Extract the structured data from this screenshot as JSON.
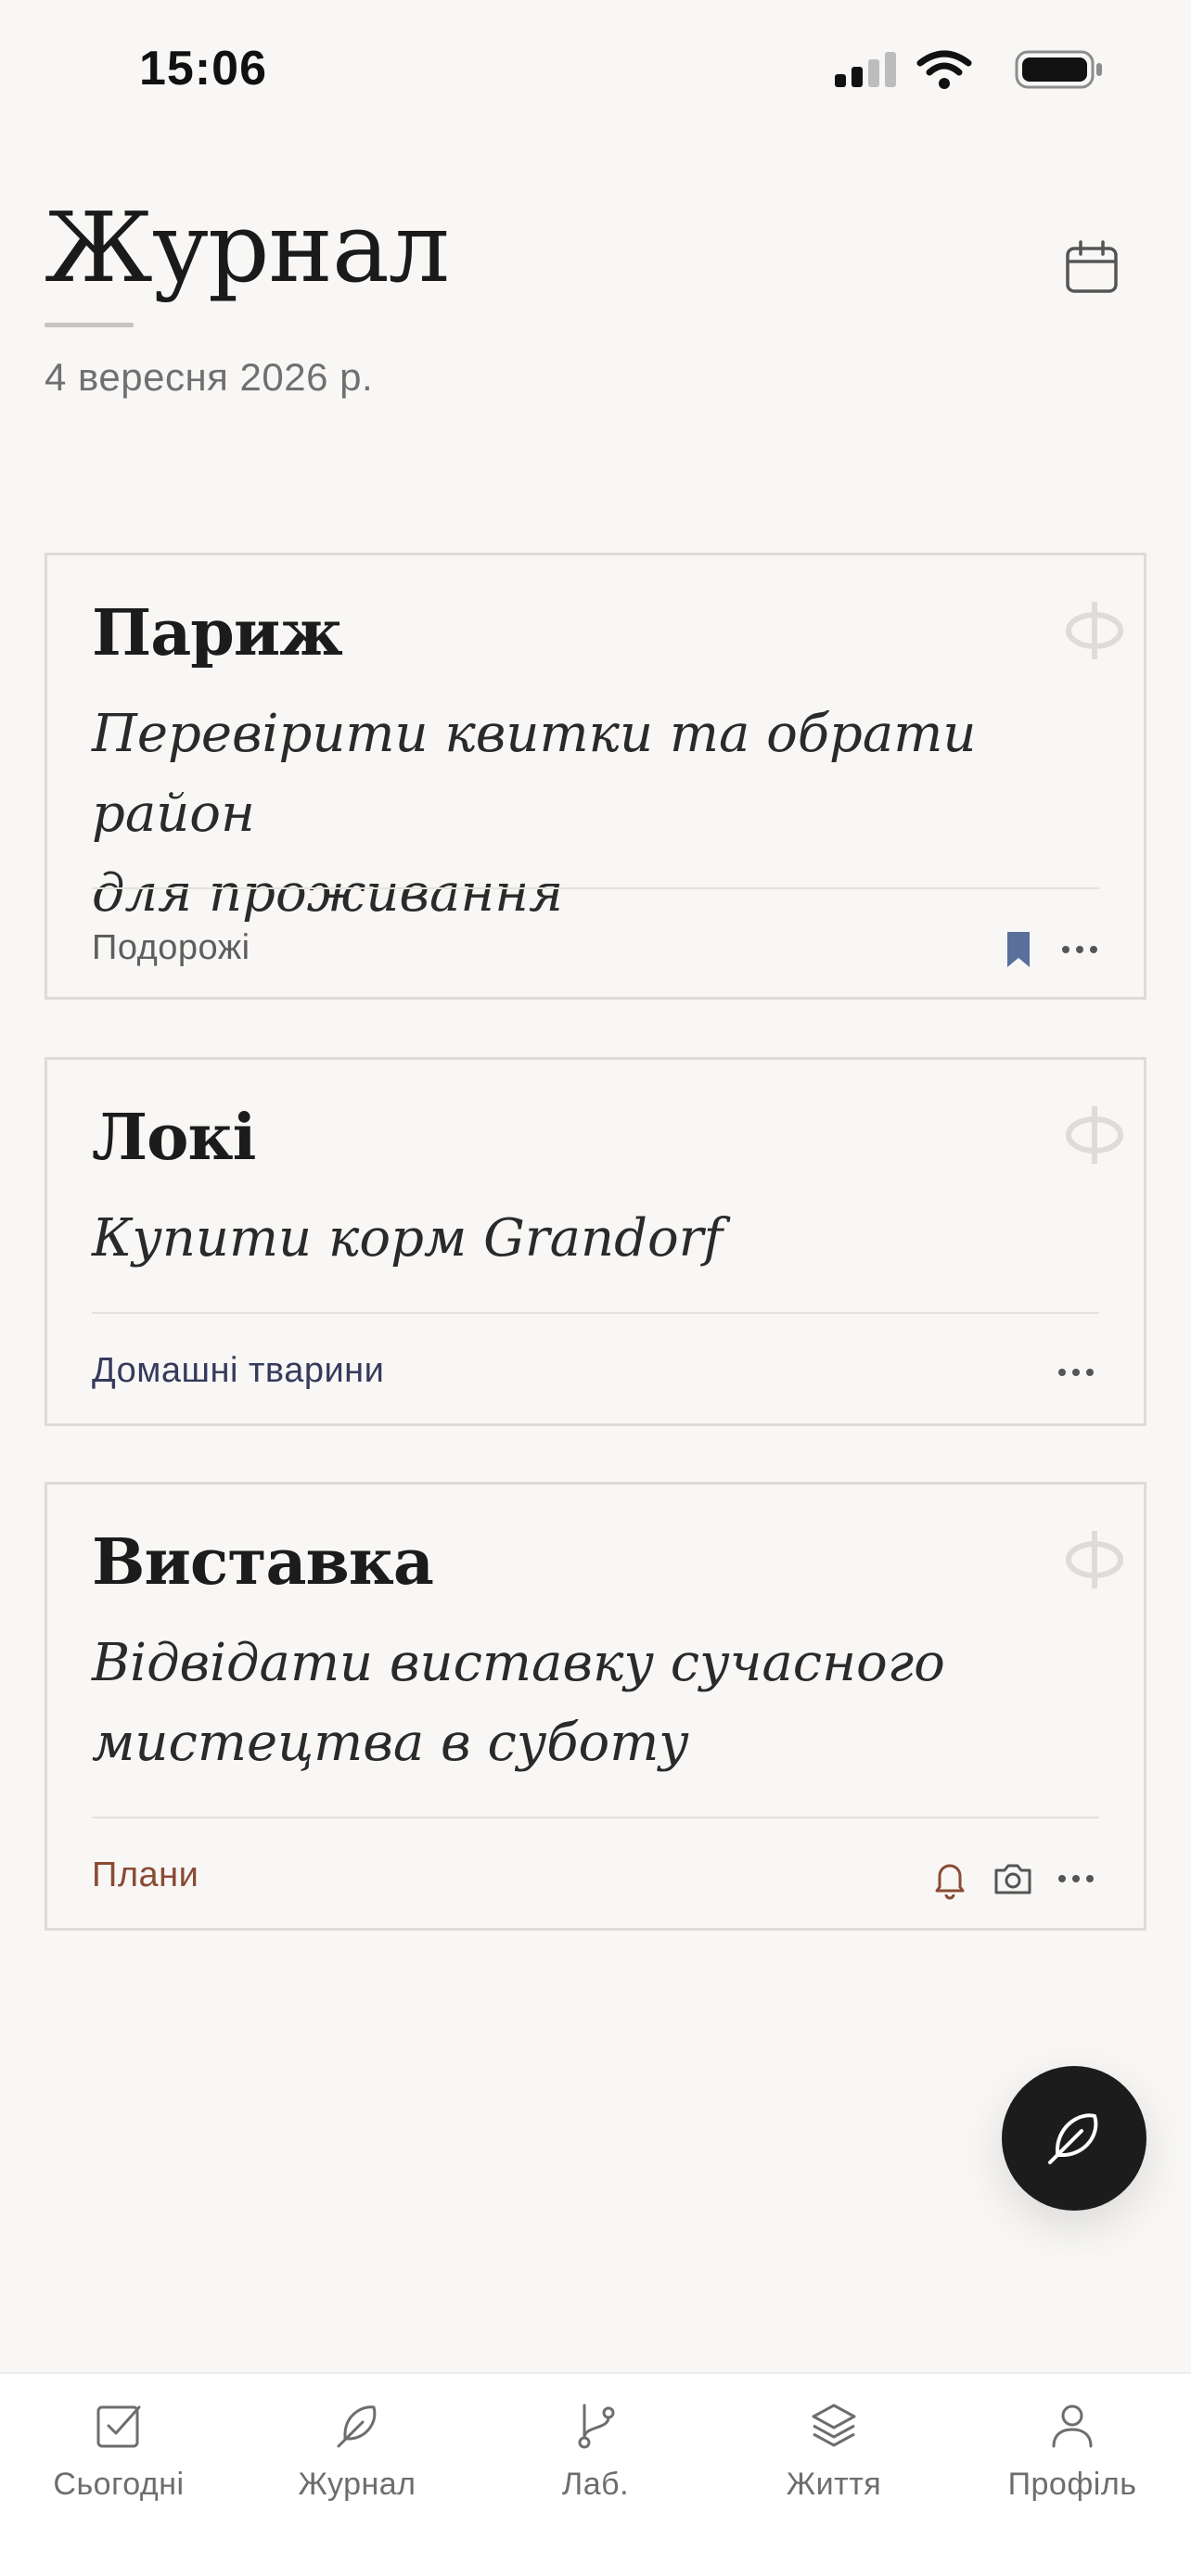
{
  "status_bar": {
    "time": "15:06"
  },
  "header": {
    "title": "Журнал",
    "date": "4 вересня 2026 р."
  },
  "entries": [
    {
      "title": "Париж",
      "body_lines": [
        "Перевірити квитки та обрати район",
        "для проживання"
      ],
      "tag": "Подорожі",
      "tag_color": "#5e5e5e",
      "actions": [
        "bookmark-icon",
        "more-icon"
      ]
    },
    {
      "title": "Локі",
      "body_lines": [
        "Купити корм Grandorf"
      ],
      "tag": "Домашні тварини",
      "tag_color": "#363a5c",
      "actions": [
        "more-icon"
      ]
    },
    {
      "title": "Виставка",
      "body_lines": [
        "Відвідати виставку сучасного",
        "мистецтва в суботу"
      ],
      "tag": "Плани",
      "tag_color": "#8a4b33",
      "actions": [
        "bell-icon",
        "camera-icon",
        "more-icon"
      ]
    }
  ],
  "colors": {
    "bookmark": "#5a6f9a",
    "accent_warm": "#8a4b33",
    "background": "#f8f7f5"
  },
  "tabs": [
    {
      "label": "Сьогодні",
      "icon": "checkbox-icon"
    },
    {
      "label": "Журнал",
      "icon": "feather-icon"
    },
    {
      "label": "Лаб.",
      "icon": "branch-icon"
    },
    {
      "label": "Життя",
      "icon": "layers-icon"
    },
    {
      "label": "Профіль",
      "icon": "user-icon"
    }
  ]
}
